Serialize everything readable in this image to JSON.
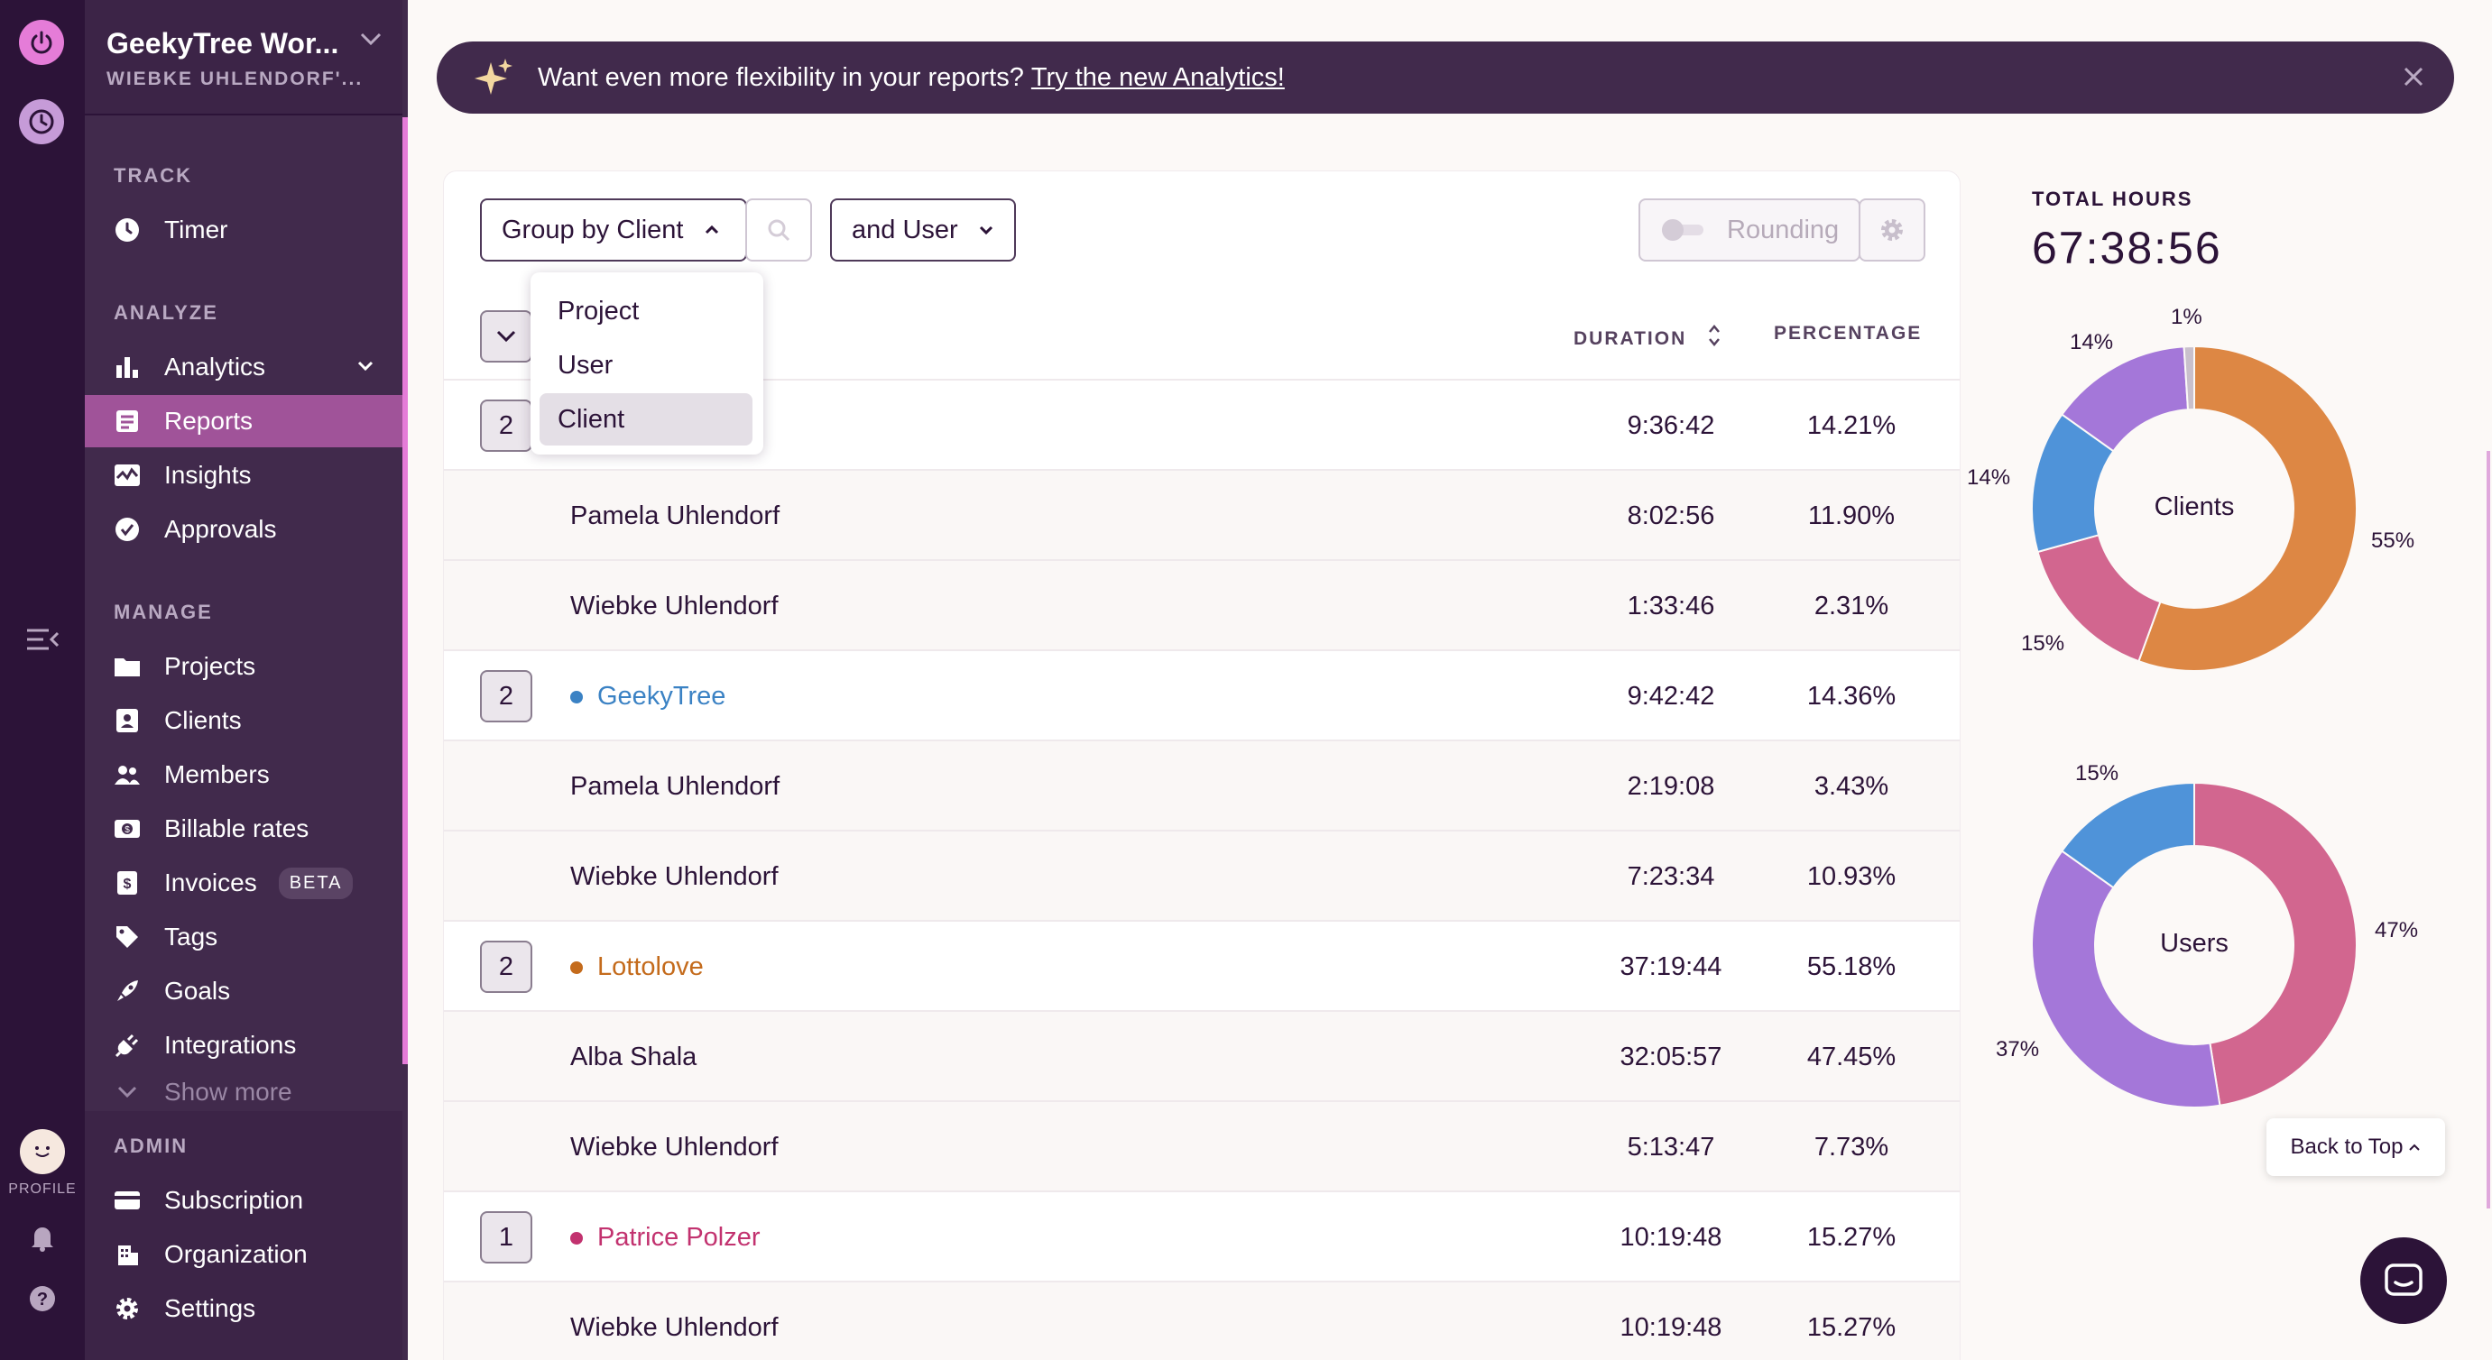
{
  "workspace": {
    "name": "GeekyTree Wor...",
    "owner": "WIEBKE UHLENDORF'..."
  },
  "rail": {
    "profile_label": "PROFILE"
  },
  "sidebar": {
    "track_label": "TRACK",
    "timer": "Timer",
    "analyze_label": "ANALYZE",
    "analytics": "Analytics",
    "reports": "Reports",
    "insights": "Insights",
    "approvals": "Approvals",
    "manage_label": "MANAGE",
    "projects": "Projects",
    "clients": "Clients",
    "members": "Members",
    "billable_rates": "Billable rates",
    "invoices": "Invoices",
    "invoices_badge": "BETA",
    "tags": "Tags",
    "goals": "Goals",
    "integrations": "Integrations",
    "show_more": "Show more",
    "admin_label": "ADMIN",
    "subscription": "Subscription",
    "organization": "Organization",
    "settings": "Settings"
  },
  "banner": {
    "text": "Want even more flexibility in your reports?",
    "link": "Try the new Analytics!"
  },
  "toolbar": {
    "group_by": "Group by Client",
    "and_user": "and User",
    "rounding": "Rounding"
  },
  "dropdown": {
    "options": [
      "Project",
      "User",
      "Client"
    ],
    "selected": "Client"
  },
  "table": {
    "col_duration": "DURATION",
    "col_percentage": "PERCENTAGE",
    "rows": [
      {
        "count": "2",
        "name": "",
        "duration": "9:36:42",
        "percentage": "14.21%"
      },
      {
        "name": "Pamela Uhlendorf",
        "duration": "8:02:56",
        "percentage": "11.90%"
      },
      {
        "name": "Wiebke Uhlendorf",
        "duration": "1:33:46",
        "percentage": "2.31%"
      },
      {
        "count": "2",
        "name": "GeekyTree",
        "color": "#3b82c4",
        "duration": "9:42:42",
        "percentage": "14.36%"
      },
      {
        "name": "Pamela Uhlendorf",
        "duration": "2:19:08",
        "percentage": "3.43%"
      },
      {
        "name": "Wiebke Uhlendorf",
        "duration": "7:23:34",
        "percentage": "10.93%"
      },
      {
        "count": "2",
        "name": "Lottolove",
        "color": "#c46b1c",
        "duration": "37:19:44",
        "percentage": "55.18%"
      },
      {
        "name": "Alba Shala",
        "duration": "32:05:57",
        "percentage": "47.45%"
      },
      {
        "name": "Wiebke Uhlendorf",
        "duration": "5:13:47",
        "percentage": "7.73%"
      },
      {
        "count": "1",
        "name": "Patrice Polzer",
        "color": "#c2326f",
        "duration": "10:19:48",
        "percentage": "15.27%"
      },
      {
        "name": "Wiebke Uhlendorf",
        "duration": "10:19:48",
        "percentage": "15.27%"
      }
    ]
  },
  "summary": {
    "total_label": "TOTAL HOURS",
    "total_value": "67:38:56"
  },
  "donuts": {
    "clients": {
      "center": "Clients",
      "segments": [
        {
          "value": 55,
          "color": "#dd8744",
          "label": "55%"
        },
        {
          "value": 15,
          "color": "#d2668f",
          "label": "15%"
        },
        {
          "value": 14,
          "color": "#4f93d9",
          "label": "14%"
        },
        {
          "value": 14,
          "color": "#a477d9",
          "label": "14%"
        },
        {
          "value": 1,
          "color": "#c9c0cc",
          "label": "1%"
        }
      ]
    },
    "users": {
      "center": "Users",
      "segments": [
        {
          "value": 47,
          "color": "#d2668f",
          "label": "47%"
        },
        {
          "value": 37,
          "color": "#a477d9",
          "label": "37%"
        },
        {
          "value": 15,
          "color": "#4f93d9",
          "label": "15%"
        }
      ]
    }
  },
  "back_to_top": "Back to Top"
}
